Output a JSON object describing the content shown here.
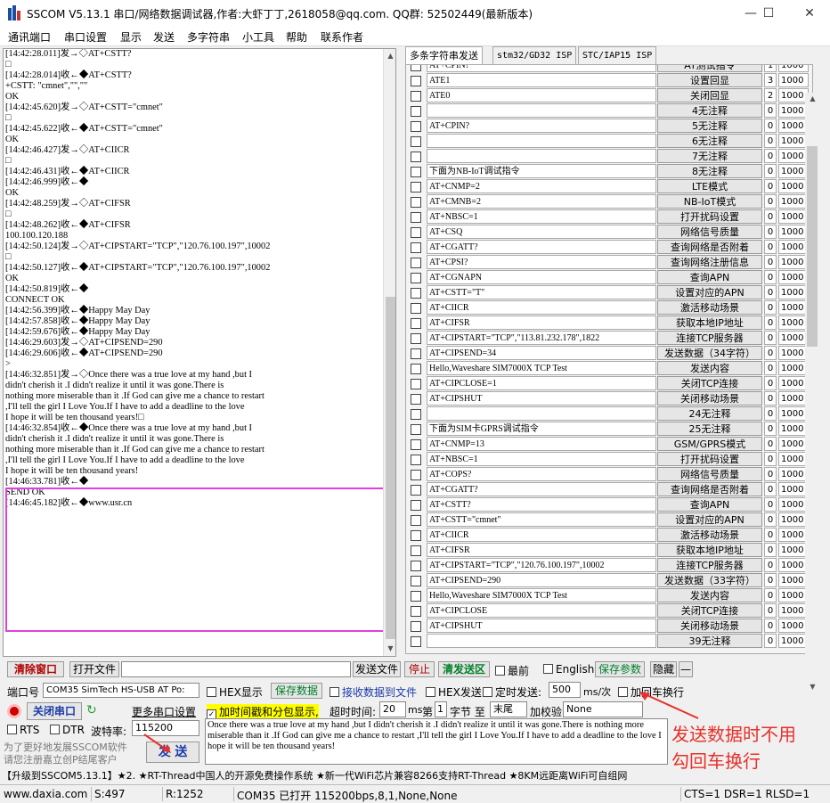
{
  "window": {
    "title": "SSCOM V5.13.1 串口/网络数据调试器,作者:大虾丁丁,2618058@qq.com. QQ群: 52502449(最新版本)",
    "minimize": "—",
    "maximize": "☐",
    "close": "✕"
  },
  "menu": [
    "通讯端口",
    "串口设置",
    "显示",
    "发送",
    "多字符串",
    "小工具",
    "帮助",
    "联系作者"
  ],
  "receive": {
    "lines": [
      "",
      "[14:42:28.011]发→◇AT+CSTT?",
      "□",
      "[14:42:28.014]收←◆AT+CSTT?",
      "+CSTT: \"cmnet\",\"\",\"\"",
      "",
      "OK",
      "",
      "",
      "[14:42:45.620]发→◇AT+CSTT=\"cmnet\"",
      "□",
      "[14:42:45.622]收←◆AT+CSTT=\"cmnet\"",
      "OK",
      "",
      "[14:42:46.427]发→◇AT+CIICR",
      "□",
      "[14:42:46.431]收←◆AT+CIICR",
      "[14:42:46.999]收←◆",
      "OK",
      "",
      "[14:42:48.259]发→◇AT+CIFSR",
      "□",
      "[14:42:48.262]收←◆AT+CIFSR",
      "100.100.120.188",
      "",
      "[14:42:50.124]发→◇AT+CIPSTART=\"TCP\",\"120.76.100.197\",10002",
      "□",
      "[14:42:50.127]收←◆AT+CIPSTART=\"TCP\",\"120.76.100.197\",10002",
      "OK",
      "",
      "[14:42:50.819]收←◆",
      "CONNECT OK",
      "",
      "[14:42:56.399]收←◆Happy May Day",
      "[14:42:57.858]收←◆Happy May Day",
      "[14:42:59.676]收←◆Happy May Day",
      "",
      "",
      "[14:46:29.603]发→◇AT+CIPSEND=290",
      "",
      "[14:46:29.606]收←◆AT+CIPSEND=290",
      ">",
      "[14:46:32.851]发→◇Once there was a true love at my hand ,but I",
      "didn't cherish it .I didn't realize it until it was gone.There is",
      "nothing more miserable than it .If God can give me a chance to restart",
      ",I'll tell the girl I Love You.If I have to add a deadline to the love",
      "I hope it will be ten thousand years!□",
      "[14:46:32.854]收←◆Once there was a true love at my hand ,but I",
      "didn't cherish it .I didn't realize it until it was gone.There is",
      "nothing more miserable than it .If God can give me a chance to restart",
      ",I'll tell the girl I Love You.If I have to add a deadline to the love",
      "I hope it will be ten thousand years!",
      "[14:46:33.781]收←◆",
      "SEND OK",
      "",
      "[14:46:45.182]收←◆www.usr.cn"
    ]
  },
  "tabs": [
    "多条字符串发送",
    "stm32/GD32 ISP",
    "STC/IAP15 ISP"
  ],
  "rows": [
    {
      "cmd": "AT+CPIN?",
      "btn": "AT测试指令",
      "ord": "1",
      "dly": "1000"
    },
    {
      "cmd": "ATE1",
      "btn": "设置回显",
      "ord": "3",
      "dly": "1000"
    },
    {
      "cmd": "ATE0",
      "btn": "关闭回显",
      "ord": "2",
      "dly": "1000"
    },
    {
      "cmd": "",
      "btn": "4无注释",
      "ord": "0",
      "dly": "1000"
    },
    {
      "cmd": "AT+CPIN?",
      "btn": "5无注释",
      "ord": "0",
      "dly": "1000"
    },
    {
      "cmd": "",
      "btn": "6无注释",
      "ord": "0",
      "dly": "1000"
    },
    {
      "cmd": "",
      "btn": "7无注释",
      "ord": "0",
      "dly": "1000"
    },
    {
      "cmd": "下面为NB-IoT调试指令",
      "btn": "8无注释",
      "ord": "0",
      "dly": "1000"
    },
    {
      "cmd": "AT+CNMP=2",
      "btn": "LTE模式",
      "ord": "0",
      "dly": "1000"
    },
    {
      "cmd": "AT+CMNB=2",
      "btn": "NB-IoT模式",
      "ord": "0",
      "dly": "1000"
    },
    {
      "cmd": "AT+NBSC=1",
      "btn": "打开扰码设置",
      "ord": "0",
      "dly": "1000"
    },
    {
      "cmd": "AT+CSQ",
      "btn": "网络信号质量",
      "ord": "0",
      "dly": "1000"
    },
    {
      "cmd": "AT+CGATT?",
      "btn": "查询网络是否附着",
      "ord": "0",
      "dly": "1000"
    },
    {
      "cmd": "AT+CPSI?",
      "btn": "查询网络注册信息",
      "ord": "0",
      "dly": "1000"
    },
    {
      "cmd": "AT+CGNAPN",
      "btn": "查询APN",
      "ord": "0",
      "dly": "1000"
    },
    {
      "cmd": "AT+CSTT=\"T\"",
      "btn": "设置对应的APN",
      "ord": "0",
      "dly": "1000"
    },
    {
      "cmd": "AT+CIICR",
      "btn": "激活移动场景",
      "ord": "0",
      "dly": "1000"
    },
    {
      "cmd": "AT+CIFSR",
      "btn": "获取本地IP地址",
      "ord": "0",
      "dly": "1000"
    },
    {
      "cmd": "AT+CIPSTART=\"TCP\",\"113.81.232.178\",1822",
      "btn": "连接TCP服务器",
      "ord": "0",
      "dly": "1000"
    },
    {
      "cmd": "AT+CIPSEND=34",
      "btn": "发送数据（34字符）",
      "ord": "0",
      "dly": "1000"
    },
    {
      "cmd": "Hello,Waveshare SIM7000X TCP Test",
      "btn": "发送内容",
      "ord": "0",
      "dly": "1000"
    },
    {
      "cmd": "AT+CIPCLOSE=1",
      "btn": "关闭TCP连接",
      "ord": "0",
      "dly": "1000"
    },
    {
      "cmd": "AT+CIPSHUT",
      "btn": "关闭移动场景",
      "ord": "0",
      "dly": "1000"
    },
    {
      "cmd": "",
      "btn": "24无注释",
      "ord": "0",
      "dly": "1000"
    },
    {
      "cmd": "下面为SIM卡GPRS调试指令",
      "btn": "25无注释",
      "ord": "0",
      "dly": "1000"
    },
    {
      "cmd": "AT+CNMP=13",
      "btn": "GSM/GPRS模式",
      "ord": "0",
      "dly": "1000"
    },
    {
      "cmd": "AT+NBSC=1",
      "btn": "打开扰码设置",
      "ord": "0",
      "dly": "1000"
    },
    {
      "cmd": "AT+COPS?",
      "btn": "网络信号质量",
      "ord": "0",
      "dly": "1000"
    },
    {
      "cmd": "AT+CGATT?",
      "btn": "查询网络是否附着",
      "ord": "0",
      "dly": "1000"
    },
    {
      "cmd": "AT+CSTT?",
      "btn": "查询APN",
      "ord": "0",
      "dly": "1000"
    },
    {
      "cmd": "AT+CSTT=\"cmnet\"",
      "btn": "设置对应的APN",
      "ord": "0",
      "dly": "1000"
    },
    {
      "cmd": "AT+CIICR",
      "btn": "激活移动场景",
      "ord": "0",
      "dly": "1000"
    },
    {
      "cmd": "AT+CIFSR",
      "btn": "获取本地IP地址",
      "ord": "0",
      "dly": "1000"
    },
    {
      "cmd": "AT+CIPSTART=\"TCP\",\"120.76.100.197\",10002",
      "btn": "连接TCP服务器",
      "ord": "0",
      "dly": "1000"
    },
    {
      "cmd": "AT+CIPSEND=290",
      "btn": "发送数据（33字符）",
      "ord": "0",
      "dly": "1000"
    },
    {
      "cmd": "Hello,Waveshare SIM7000X TCP Test",
      "btn": "发送内容",
      "ord": "0",
      "dly": "1000"
    },
    {
      "cmd": "AT+CIPCLOSE",
      "btn": "关闭TCP连接",
      "ord": "0",
      "dly": "1000"
    },
    {
      "cmd": "AT+CIPSHUT",
      "btn": "关闭移动场景",
      "ord": "0",
      "dly": "1000"
    },
    {
      "cmd": "",
      "btn": "39无注释",
      "ord": "0",
      "dly": "1000"
    }
  ],
  "toolbar": {
    "clear": "清除窗口",
    "open_file": "打开文件",
    "send_file": "发送文件",
    "stop": "停止",
    "clear_send": "清发送区",
    "last": "最前",
    "english": "English",
    "save_params": "保存参数",
    "hide": "隐藏",
    "dash": "—"
  },
  "port": {
    "label": "端口号",
    "value": "COM35 SimTech HS-USB AT Po:",
    "close_btn": "关闭串口",
    "more": "更多串口设置",
    "rts": "RTS",
    "dtr": "DTR",
    "baud_label": "波特率:",
    "baud": "115200",
    "send_btn": "发 送",
    "promo1": "为了更好地发展SSCOM软件",
    "promo2": "请您注册嘉立创P结尾客户"
  },
  "options": {
    "hex_show": "HEX显示",
    "save_data": "保存数据",
    "recv_to_file": "接收数据到文件",
    "hex_send": "HEX发送",
    "timed_send": "定时发送:",
    "interval": "500",
    "ms_per": "ms/次",
    "add_crlf": "加回车换行",
    "timestamp": "加时间戳和分包显示,",
    "timeout_label": "超时时间:",
    "timeout": "20",
    "ms": "ms",
    "page_label": "第",
    "page": "1",
    "byte_label": "字节 至",
    "end": "末尾",
    "checksum_label": "加校验",
    "checksum": "None"
  },
  "send_text": "Once there was a true love at my hand ,but I didn't cherish it .I didn't realize it until it was gone.There is nothing more miserable than it .If God can give me a chance to restart ,I'll tell the girl I Love You.If I have to add a deadline to the love I hope it will be ten thousand years!",
  "annotation": {
    "line1": "发送数据时不用",
    "line2": "勾回车换行",
    "color": "#e8302a"
  },
  "ticker": "【升级到SSCOM5.13.1】★2. ★RT-Thread中国人的开源免费操作系统 ★新一代WiFi芯片兼容8266支持RT-Thread ★8KM远距离WiFi可自组网",
  "status": {
    "site": "www.daxia.com",
    "sent": "S:497",
    "recv": "R:1252",
    "port": "COM35 已打开  115200bps,8,1,None,None",
    "lines": "CTS=1 DSR=1 RLSD=1"
  },
  "colors": {
    "highlight": "#e040e0",
    "stop": "#b00000",
    "green": "#00802b",
    "timestamp_bg": "#ffff00"
  }
}
